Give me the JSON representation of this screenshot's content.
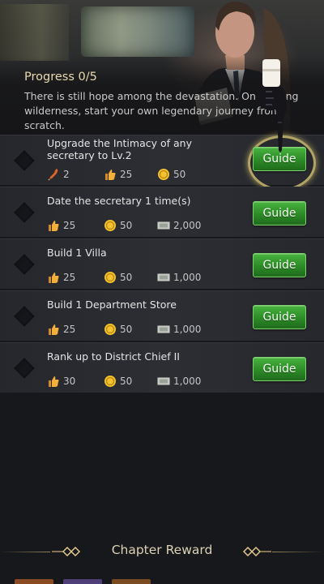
{
  "header": {
    "progress": "Progress 0/5",
    "story": "There is still hope among the devastation. On howling wilderness, start your own legendary journey from scratch."
  },
  "tasks": [
    {
      "title": "Upgrade the Intimacy of any secretary to Lv.2",
      "rewards": [
        {
          "icon": "feather-pen-icon",
          "value": "2"
        },
        {
          "icon": "thumbs-up-icon",
          "value": "25"
        },
        {
          "icon": "gold-coin-icon",
          "value": "50"
        }
      ],
      "button": "Guide",
      "highlighted": true
    },
    {
      "title": "Date the secretary 1 time(s)",
      "rewards": [
        {
          "icon": "thumbs-up-icon",
          "value": "25"
        },
        {
          "icon": "gold-coin-icon",
          "value": "50"
        },
        {
          "icon": "cash-icon",
          "value": "2,000"
        }
      ],
      "button": "Guide",
      "highlighted": false
    },
    {
      "title": "Build 1 Villa",
      "rewards": [
        {
          "icon": "thumbs-up-icon",
          "value": "25"
        },
        {
          "icon": "gold-coin-icon",
          "value": "50"
        },
        {
          "icon": "cash-icon",
          "value": "1,000"
        }
      ],
      "button": "Guide",
      "highlighted": false
    },
    {
      "title": "Build 1 Department Store",
      "rewards": [
        {
          "icon": "thumbs-up-icon",
          "value": "25"
        },
        {
          "icon": "gold-coin-icon",
          "value": "50"
        },
        {
          "icon": "cash-icon",
          "value": "1,000"
        }
      ],
      "button": "Guide",
      "highlighted": false
    },
    {
      "title": "Rank up to District Chief II",
      "rewards": [
        {
          "icon": "thumbs-up-icon",
          "value": "30"
        },
        {
          "icon": "gold-coin-icon",
          "value": "50"
        },
        {
          "icon": "cash-icon",
          "value": "1,000"
        }
      ],
      "button": "Guide",
      "highlighted": false
    }
  ],
  "footer": {
    "chapter_reward": "Chapter Reward"
  },
  "colors": {
    "guide_green": "#2c8a27",
    "highlight_gold": "#e2ce78",
    "progress_text": "#e9d9b0"
  }
}
